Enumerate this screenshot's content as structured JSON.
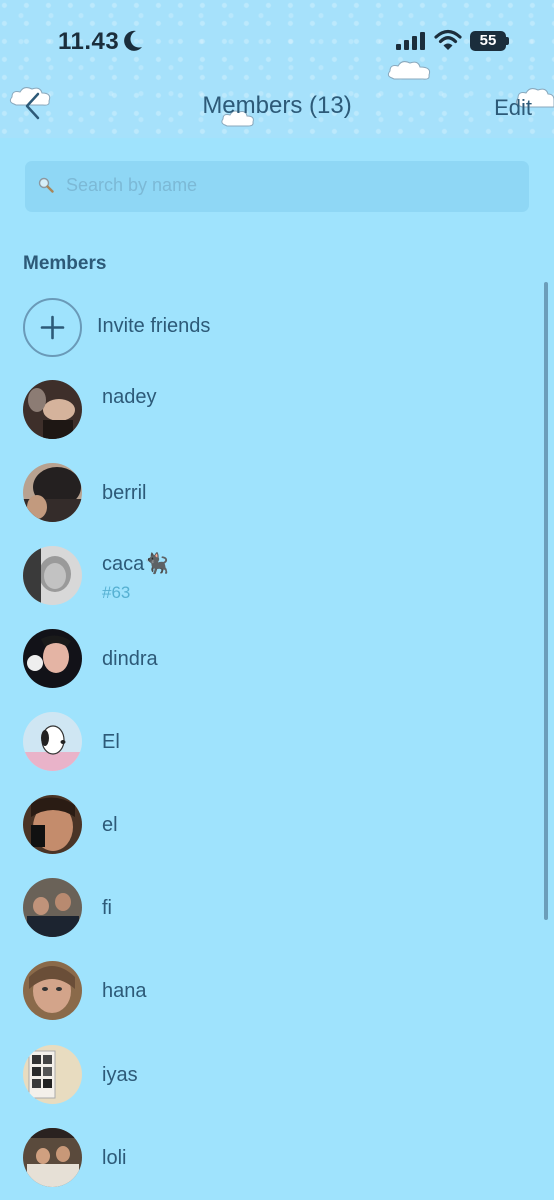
{
  "status_bar": {
    "time": "11.43",
    "battery": "55"
  },
  "header": {
    "title": "Members (13)",
    "edit_label": "Edit"
  },
  "search": {
    "placeholder": "Search by name"
  },
  "section": {
    "title": "Members"
  },
  "invite": {
    "label": "Invite friends"
  },
  "members": [
    {
      "name": "nadey"
    },
    {
      "name": "berril"
    },
    {
      "name": "caca🐈‍⬛",
      "sub": "#63"
    },
    {
      "name": "dindra"
    },
    {
      "name": "El"
    },
    {
      "name": "el"
    },
    {
      "name": "fi"
    },
    {
      "name": "hana"
    },
    {
      "name": "iyas"
    },
    {
      "name": "loli"
    }
  ],
  "colors": {
    "background": "#9fe3fd",
    "text": "#2d5a78",
    "accent_sub": "#56b0d2",
    "search_bg": "#8fd7f5"
  }
}
